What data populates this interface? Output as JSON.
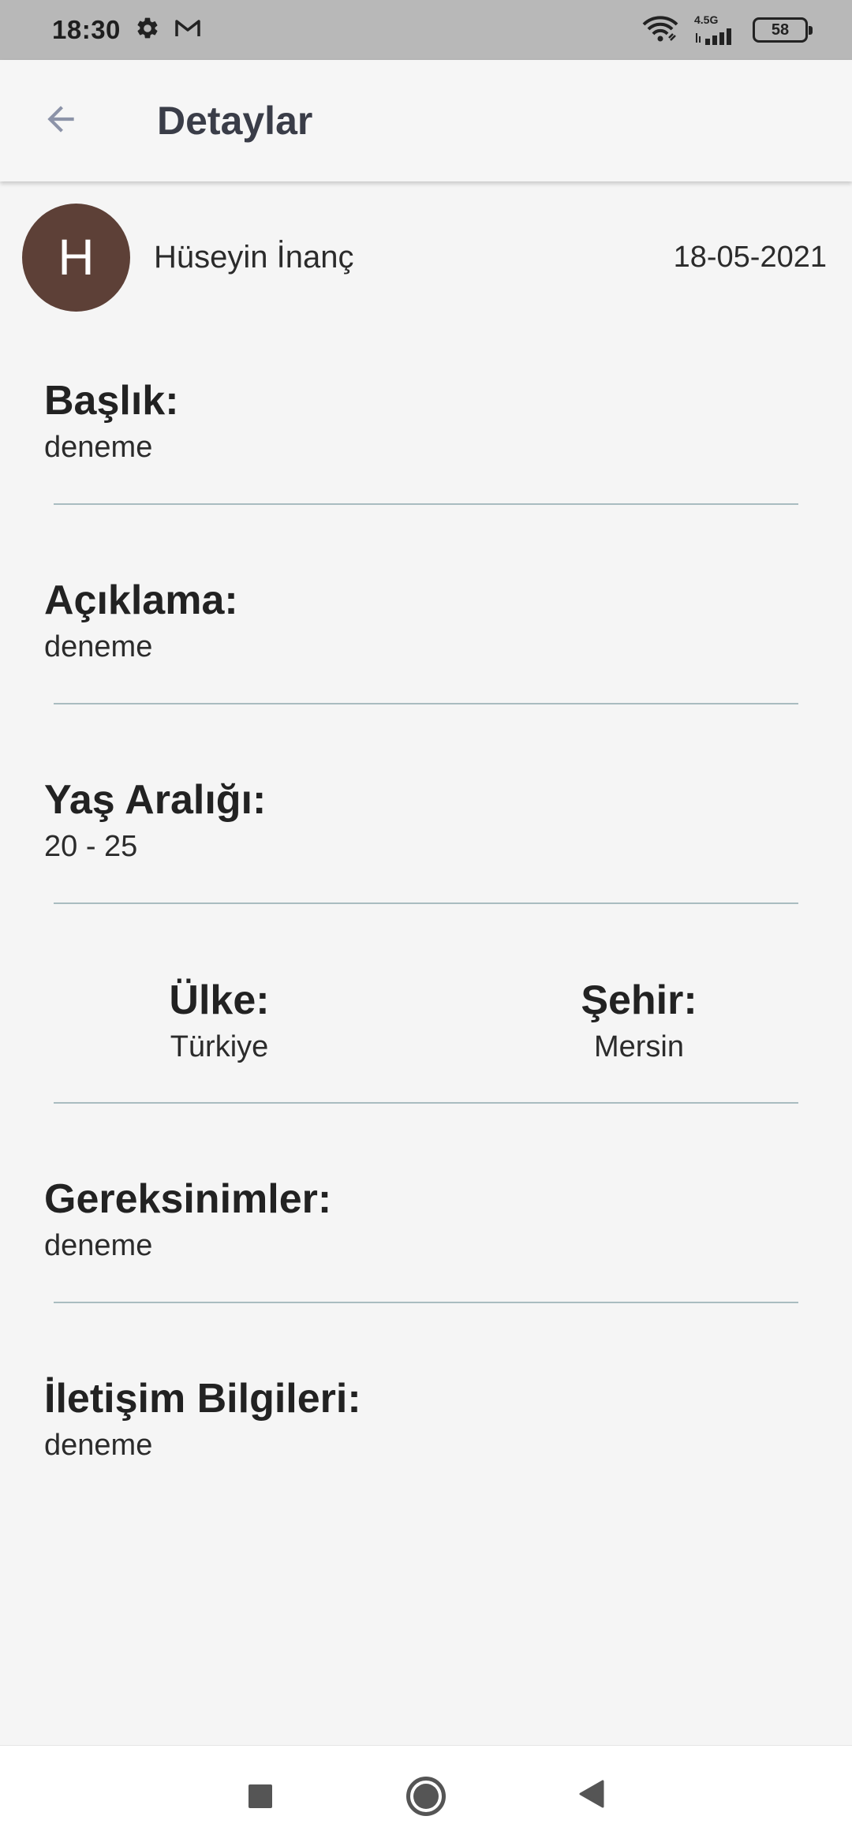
{
  "status_bar": {
    "time": "18:30",
    "left_icons": [
      "gear-icon",
      "gmail-icon"
    ],
    "network_label": "4.5G",
    "battery_level": "58"
  },
  "app_bar": {
    "title": "Detaylar",
    "back_icon": "arrow-left-icon"
  },
  "author": {
    "avatar_letter": "H",
    "avatar_color": "#5d4037",
    "name": "Hüseyin İnanç",
    "date": "18-05-2021"
  },
  "details": {
    "baslik": {
      "label": "Başlık:",
      "value": "deneme"
    },
    "aciklama": {
      "label": "Açıklama:",
      "value": "deneme"
    },
    "yas_araligi": {
      "label": "Yaş Aralığı:",
      "value": "20 - 25"
    },
    "ulke": {
      "label": "Ülke:",
      "value": "Türkiye"
    },
    "sehir": {
      "label": "Şehir:",
      "value": "Mersin"
    },
    "gereksinimler": {
      "label": "Gereksinimler:",
      "value": "deneme"
    },
    "iletisim": {
      "label": "İletişim Bilgileri:",
      "value": "deneme"
    }
  },
  "nav_bar": {
    "buttons": [
      "recents-square-icon",
      "home-circle-icon",
      "back-triangle-icon"
    ]
  }
}
